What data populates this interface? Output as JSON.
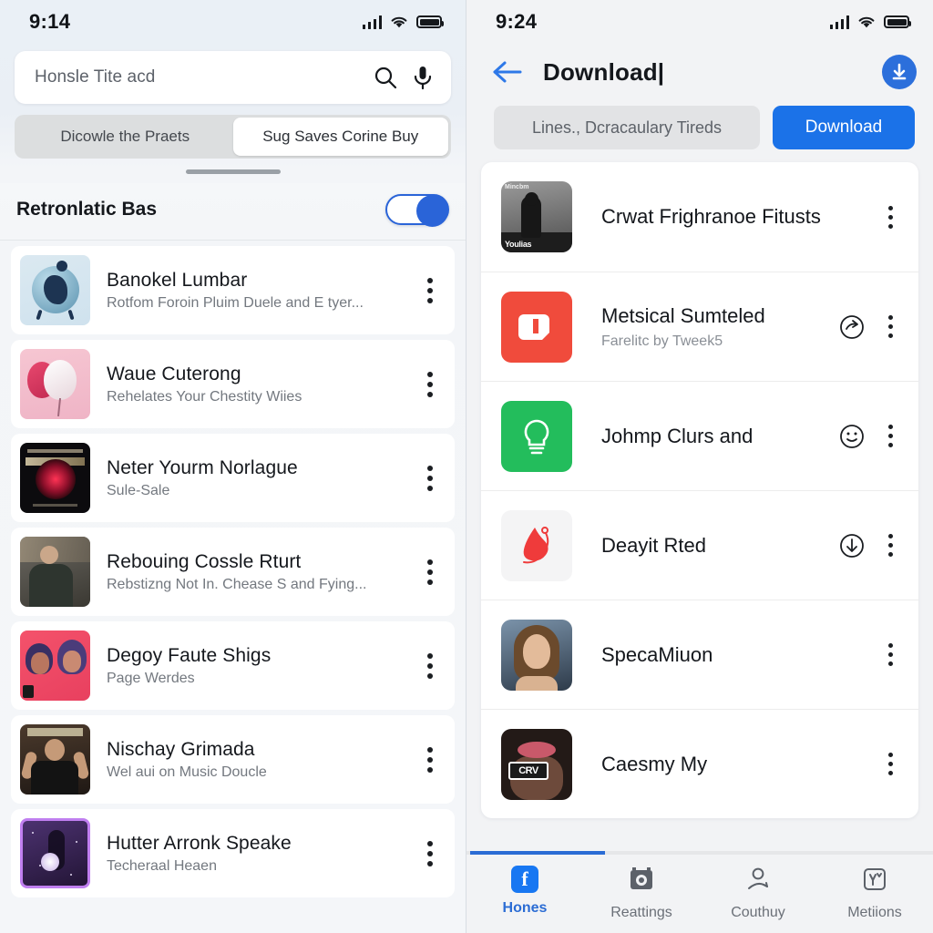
{
  "left": {
    "status": {
      "time": "9:14",
      "signal_icon": "cellular-signal-icon",
      "wifi_icon": "wifi-icon",
      "battery_icon": "battery-icon"
    },
    "search": {
      "placeholder": "Honsle Tite acd",
      "search_icon": "search-icon",
      "mic_icon": "microphone-icon"
    },
    "segments": [
      {
        "label": "Dicowle the Praets",
        "active": false
      },
      {
        "label": "Sug Saves Corine Buy",
        "active": true
      }
    ],
    "section": {
      "title": "Retronlatic Bas",
      "toggle_on": true
    },
    "items": [
      {
        "title": "Banokel Lumbar",
        "subtitle": "Rotfom Foroin Pluim Duele and E tyer...",
        "art": "globe-alarm-clock"
      },
      {
        "title": "Waue Cuterong",
        "subtitle": "Rehelates Your Chestity Wiies",
        "art": "pink-balloons"
      },
      {
        "title": "Neter Yourm Norlague",
        "subtitle": "Sule-Sale",
        "art": "dark-album-cover"
      },
      {
        "title": "Rebouing Cossle Rturt",
        "subtitle": "Rebstizng Not In. Chease S and Fying...",
        "art": "man-photo"
      },
      {
        "title": "Degoy Faute Shigs",
        "subtitle": "Page Werdes",
        "art": "pink-portrait"
      },
      {
        "title": "Nischay Grimada",
        "subtitle": "Wel aui on Music Doucle",
        "art": "man-black-shirt"
      },
      {
        "title": "Hutter Arronk Speake",
        "subtitle": "Techeraal Heaen",
        "art": "purple-cosmic"
      }
    ]
  },
  "right": {
    "status": {
      "time": "9:24",
      "signal_icon": "cellular-signal-icon",
      "wifi_icon": "wifi-icon",
      "battery_icon": "battery-icon"
    },
    "header": {
      "back_icon": "back-arrow-icon",
      "title": "Download|",
      "badge_icon": "download-circle-icon"
    },
    "actions": {
      "url_placeholder": "Lines., Dcracaulary Tireds",
      "download_label": "Download"
    },
    "items": [
      {
        "title": "Crwat Frighranoe Fitusts",
        "subtitle": "",
        "art": "youtube-grayscale",
        "action_icon": ""
      },
      {
        "title": "Metsical Sumteled",
        "subtitle": "Farelitc by Tweek5",
        "art": "red-app",
        "action_icon": "share-circle-icon"
      },
      {
        "title": "Johmp Clurs and",
        "subtitle": "",
        "art": "green-bulb",
        "action_icon": "smile-circle-icon"
      },
      {
        "title": "Deayit Rted",
        "subtitle": "",
        "art": "red-outline",
        "action_icon": "download-circle-icon"
      },
      {
        "title": "SpecaMiuon",
        "subtitle": "",
        "art": "woman-photo",
        "action_icon": ""
      },
      {
        "title": "Caesmy My",
        "subtitle": "",
        "art": "lips-photo",
        "action_icon": ""
      }
    ],
    "tabs": [
      {
        "label": "Hones",
        "icon": "facebook-icon",
        "active": true
      },
      {
        "label": "Reattings",
        "icon": "camera-icon",
        "active": false
      },
      {
        "label": "Couthuy",
        "icon": "person-icon",
        "active": false
      },
      {
        "label": "Metiions",
        "icon": "mentions-icon",
        "active": false
      }
    ]
  },
  "colors": {
    "accent": "#1b72e8",
    "toggle": "#2a64d8",
    "tab_active": "#2b6cd4"
  }
}
